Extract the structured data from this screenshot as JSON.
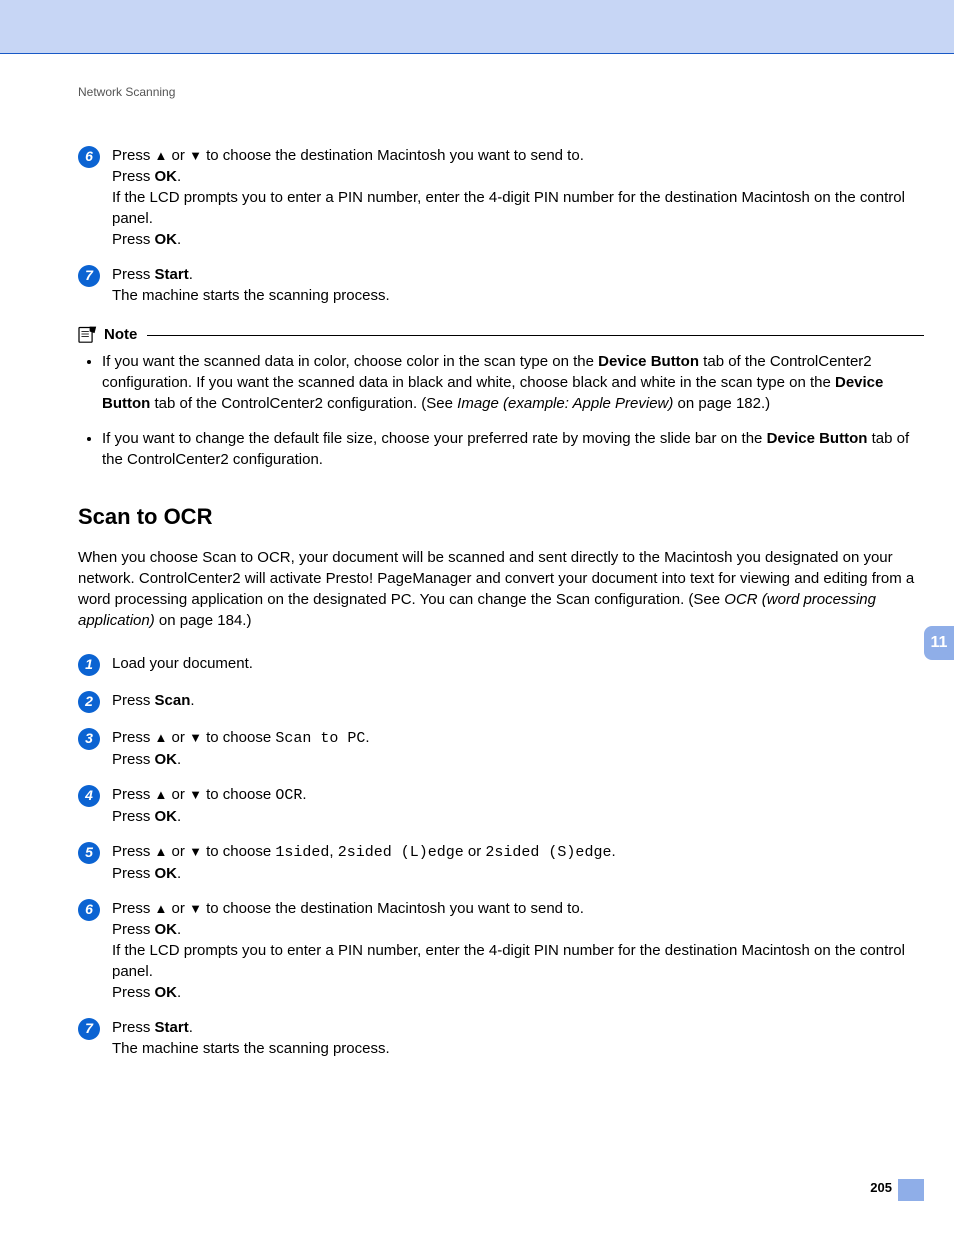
{
  "header": "Network Scanning",
  "topSteps": {
    "s6": {
      "n": "6",
      "l1a": "Press ",
      "l1b": " or ",
      "l1c": " to choose the destination Macintosh you want to send to.",
      "l2a": "Press ",
      "l2b": "OK",
      "l2c": ".",
      "l3": "If the LCD prompts you to enter a PIN number, enter the 4-digit PIN number for the destination Macintosh on the control panel.",
      "l4a": "Press ",
      "l4b": "OK",
      "l4c": "."
    },
    "s7": {
      "n": "7",
      "l1a": "Press ",
      "l1b": "Start",
      "l1c": ".",
      "l2": "The machine starts the scanning process."
    }
  },
  "note": {
    "label": "Note",
    "b1a": "If you want the scanned data in color, choose color in the scan type on the ",
    "b1b": "Device Button",
    "b1c": " tab of the ControlCenter2 configuration. If you want the scanned data in black and white, choose black and white in the scan type on the ",
    "b1d": "Device Button",
    "b1e": " tab of the ControlCenter2 configuration. (See ",
    "b1f": "Image (example: Apple Preview)",
    "b1g": " on page 182.)",
    "b2a": "If you want to change the default file size, choose your preferred rate by moving the slide bar on the ",
    "b2b": "Device Button",
    "b2c": " tab of the ControlCenter2 configuration."
  },
  "sectionTitle": "Scan to OCR",
  "intro": {
    "a": "When you choose Scan to OCR, your document will be scanned and sent directly to the Macintosh you designated on your network. ControlCenter2 will activate Presto! PageManager and convert your document into text for viewing and editing from a word processing application on the designated PC. You can change the Scan configuration. (See ",
    "b": "OCR (word processing application)",
    "c": " on page 184.)"
  },
  "steps": {
    "s1": {
      "n": "1",
      "t": "Load your document."
    },
    "s2": {
      "n": "2",
      "a": "Press ",
      "b": "Scan",
      "c": "."
    },
    "s3": {
      "n": "3",
      "a": "Press ",
      "b": " or ",
      "c": " to choose ",
      "m": "Scan to PC",
      "d": ".",
      "e": "Press ",
      "f": "OK",
      "g": "."
    },
    "s4": {
      "n": "4",
      "a": "Press ",
      "b": " or ",
      "c": " to choose ",
      "m": "OCR",
      "d": ".",
      "e": "Press ",
      "f": "OK",
      "g": "."
    },
    "s5": {
      "n": "5",
      "a": "Press ",
      "b": " or ",
      "c": " to choose ",
      "m1": "1sided",
      "m2": "2sided (L)edge",
      "m3": "2sided (S)edge",
      "sep1": ", ",
      "sep2": " or ",
      "d": ".",
      "e": "Press ",
      "f": "OK",
      "g": "."
    },
    "s6": {
      "n": "6",
      "l1a": "Press ",
      "l1b": " or ",
      "l1c": " to choose the destination Macintosh you want to send to.",
      "l2a": "Press ",
      "l2b": "OK",
      "l2c": ".",
      "l3": "If the LCD prompts you to enter a PIN number, enter the 4-digit PIN number for the destination Macintosh on the control panel.",
      "l4a": "Press ",
      "l4b": "OK",
      "l4c": "."
    },
    "s7": {
      "n": "7",
      "l1a": "Press ",
      "l1b": "Start",
      "l1c": ".",
      "l2": "The machine starts the scanning process."
    }
  },
  "sideTab": "11",
  "pageNumber": "205",
  "glyph": {
    "up": "▲",
    "down": "▼"
  }
}
